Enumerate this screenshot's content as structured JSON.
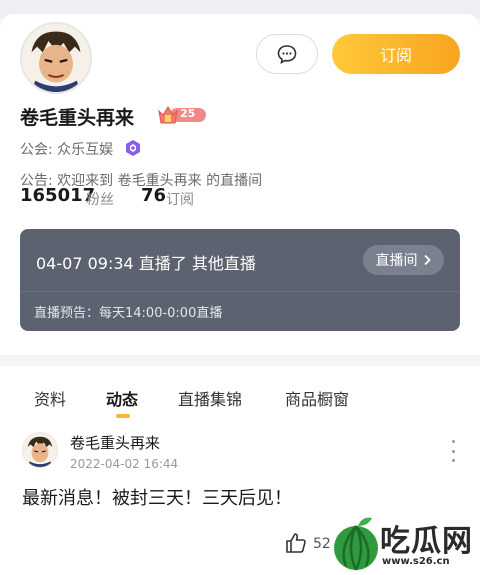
{
  "header": {
    "subscribe_label": "订阅",
    "message_icon": "chat-bubble-icon"
  },
  "profile": {
    "name": "卷毛重头再来",
    "level": "25",
    "guild_label": "公会: 众乐互娱",
    "notice": "公告: 欢迎来到 卷毛重头再来 的直播间",
    "fans_count": "165017",
    "fans_label": "粉丝",
    "subs_count": "76",
    "subs_label": "订阅"
  },
  "live": {
    "status_line": "04-07 09:34 直播了 其他直播",
    "room_button": "直播间",
    "preview": "直播预告：每天14:00-0:00直播"
  },
  "tabs": [
    "资料",
    "动态",
    "直播集锦",
    "商品橱窗"
  ],
  "active_tab": "动态",
  "post": {
    "author": "卷毛重头再来",
    "time": "2022-04-02 16:44",
    "text": "最新消息！被封三天！三天后见！",
    "likes": "52"
  },
  "watermark": {
    "text": "吃瓜网",
    "url": "www.s26.cn"
  },
  "colors": {
    "accent": "#f7a51e",
    "live_box": "#5c6270",
    "level_badge": "#f08a8a",
    "guild_icon": "#8a5cf0"
  }
}
